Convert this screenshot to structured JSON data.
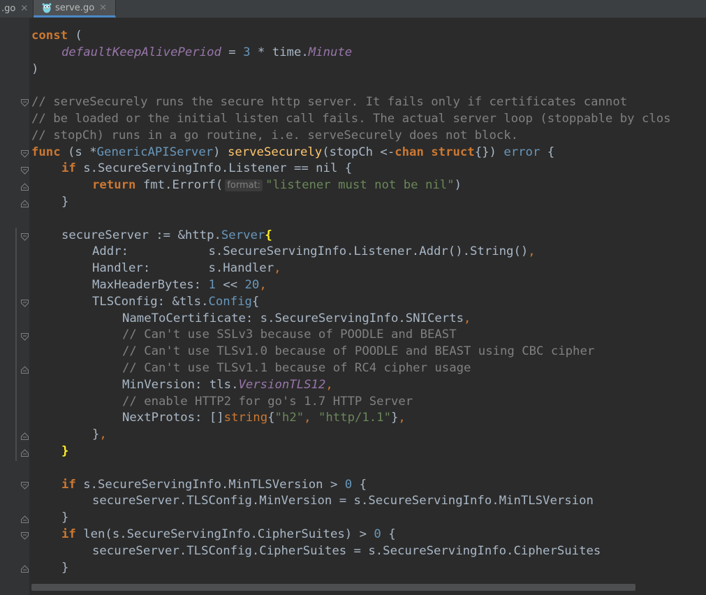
{
  "tabs": [
    {
      "label": ".go",
      "close": "✕",
      "active": false
    },
    {
      "label": "serve.go",
      "close": "✕",
      "active": true,
      "icon": "go-gopher-icon"
    }
  ],
  "colors": {
    "background": "#2b2b2b",
    "keyword": "#cc7832",
    "comment": "#808080",
    "string": "#6a8759",
    "number": "#6897bb",
    "function": "#ffc66d",
    "constant": "#9876aa",
    "text": "#a9b7c6",
    "matched_brace": "#ffef28"
  },
  "code": {
    "l01": [
      "const",
      " ("
    ],
    "l02": [
      "defaultKeepAlivePeriod",
      " = ",
      "3",
      " * time.",
      "Minute"
    ],
    "l03": [
      ")"
    ],
    "l04": [],
    "l05": [
      "// serveSecurely runs the secure http server. It fails only if certificates cannot"
    ],
    "l06": [
      "// be loaded or the initial listen call fails. The actual server loop (stoppable by clos"
    ],
    "l07": [
      "// stopCh) runs in a go routine, i.e. serveSecurely does not block."
    ],
    "l08": [
      "func",
      " (s *",
      "GenericAPIServer",
      ") ",
      "serveSecurely",
      "(stopCh <-",
      "chan",
      " ",
      "struct",
      "{}) ",
      "error",
      " {"
    ],
    "l09": [
      "if",
      " s.SecureServingInfo.Listener == nil {"
    ],
    "l10": [
      "return",
      " fmt.Errorf(",
      "format:",
      "\"listener must not be nil\"",
      ")"
    ],
    "l11": [
      "}"
    ],
    "l12": [],
    "l13": [
      "secureServer := &http.",
      "Server",
      "{"
    ],
    "l14": [
      "Addr:           s.SecureServingInfo.Listener.Addr().String()",
      ","
    ],
    "l15": [
      "Handler:        s.Handler",
      ","
    ],
    "l16": [
      "MaxHeaderBytes: ",
      "1",
      " << ",
      "20",
      ","
    ],
    "l17": [
      "TLSConfig: &tls.",
      "Config",
      "{"
    ],
    "l18": [
      "NameToCertificate: s.SecureServingInfo.SNICerts",
      ","
    ],
    "l19": [
      "// Can't use SSLv3 because of POODLE and BEAST"
    ],
    "l20": [
      "// Can't use TLSv1.0 because of POODLE and BEAST using CBC cipher"
    ],
    "l21": [
      "// Can't use TLSv1.1 because of RC4 cipher usage"
    ],
    "l22": [
      "MinVersion: tls.",
      "VersionTLS12",
      ","
    ],
    "l23": [
      "// enable HTTP2 for go's 1.7 HTTP Server"
    ],
    "l24": [
      "NextProtos: []",
      "string",
      "{",
      "\"h2\"",
      ", ",
      "\"http/1.1\"",
      "}",
      ","
    ],
    "l25": [
      "}",
      ","
    ],
    "l26": [
      "}"
    ],
    "l27": [],
    "l28": [
      "if",
      " s.SecureServingInfo.MinTLSVersion > ",
      "0",
      " {"
    ],
    "l29": [
      "secureServer.TLSConfig.MinVersion = s.SecureServingInfo.MinTLSVersion"
    ],
    "l30": [
      "}"
    ],
    "l31": [
      "if",
      " len(s.SecureServingInfo.CipherSuites) > ",
      "0",
      " {"
    ],
    "l32": [
      "secureServer.TLSConfig.CipherSuites = s.SecureServingInfo.CipherSuites"
    ],
    "l33": [
      "}"
    ]
  }
}
